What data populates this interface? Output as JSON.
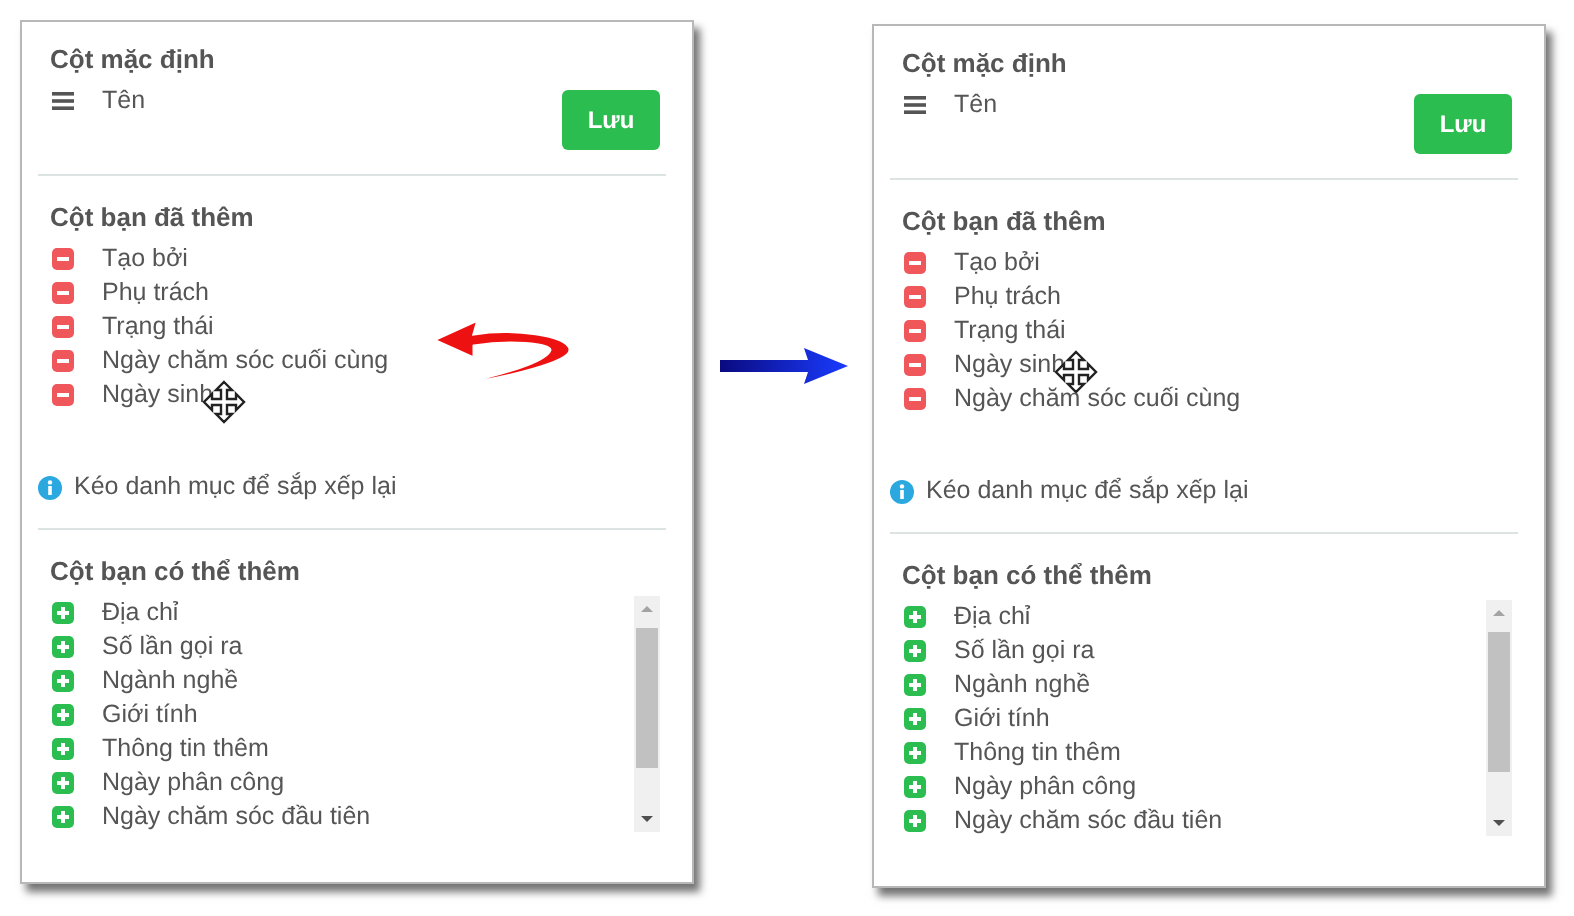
{
  "panels": [
    {
      "default_heading": "Cột mặc định",
      "default_columns": [
        "Tên"
      ],
      "save_button": "Lưu",
      "added_heading": "Cột bạn đã thêm",
      "added_columns": [
        {
          "label": "Tạo bởi",
          "dragging": false
        },
        {
          "label": "Phụ trách",
          "dragging": false
        },
        {
          "label": "Trạng thái",
          "dragging": false
        },
        {
          "label": "Ngày chăm sóc cuối cùng",
          "dragging": false
        },
        {
          "label": "Ngày sinh",
          "dragging": true
        }
      ],
      "drag_arrow": true,
      "hint": "Kéo danh mục để sắp xếp lại",
      "available_heading": "Cột bạn có thể thêm",
      "available_columns": [
        "Địa chỉ",
        "Số lần gọi ra",
        "Ngành nghề",
        "Giới tính",
        "Thông tin thêm",
        "Ngày phân công",
        "Ngày chăm sóc đầu tiên"
      ]
    },
    {
      "default_heading": "Cột mặc định",
      "default_columns": [
        "Tên"
      ],
      "save_button": "Lưu",
      "added_heading": "Cột bạn đã thêm",
      "added_columns": [
        {
          "label": "Tạo bởi",
          "dragging": false
        },
        {
          "label": "Phụ trách",
          "dragging": false
        },
        {
          "label": "Trạng thái",
          "dragging": false
        },
        {
          "label": "Ngày sinh",
          "dragging": true
        },
        {
          "label": "Ngày chăm sóc cuối cùng",
          "dragging": false
        }
      ],
      "drag_arrow": false,
      "hint": "Kéo danh mục để sắp xếp lại",
      "available_heading": "Cột bạn có thể thêm",
      "available_columns": [
        "Địa chỉ",
        "Số lần gọi ra",
        "Ngành nghề",
        "Giới tính",
        "Thông tin thêm",
        "Ngày phân công",
        "Ngày chăm sóc đầu tiên"
      ]
    }
  ]
}
